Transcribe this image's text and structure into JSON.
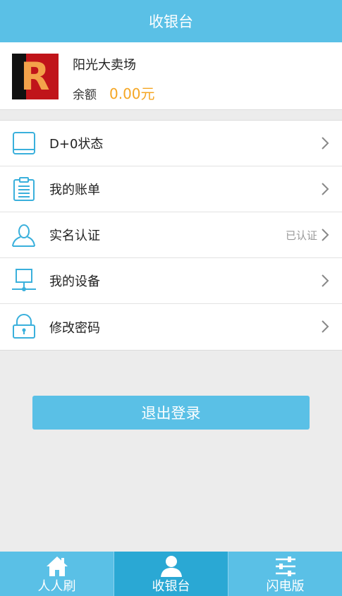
{
  "header": {
    "title": "收银台"
  },
  "profile": {
    "logo_letter": "R",
    "merchant_name": "阳光大卖场",
    "balance_label": "余额",
    "balance_value": "0.00元"
  },
  "menu": {
    "items": [
      {
        "label": "D+0状态",
        "status": "",
        "icon": "book-icon"
      },
      {
        "label": "我的账单",
        "status": "",
        "icon": "clipboard-icon"
      },
      {
        "label": "实名认证",
        "status": "已认证",
        "icon": "user-icon"
      },
      {
        "label": "我的设备",
        "status": "",
        "icon": "device-icon"
      },
      {
        "label": "修改密码",
        "status": "",
        "icon": "lock-icon"
      }
    ]
  },
  "logout": {
    "label": "退出登录"
  },
  "tabbar": {
    "tabs": [
      {
        "label": "人人刷",
        "icon": "home-icon",
        "active": false
      },
      {
        "label": "收银台",
        "icon": "person-icon",
        "active": true
      },
      {
        "label": "闪电版",
        "icon": "sliders-icon",
        "active": false
      }
    ]
  },
  "colors": {
    "primary": "#5ac0e6",
    "active_tab": "#2aa8d4",
    "balance": "#f5a623"
  }
}
